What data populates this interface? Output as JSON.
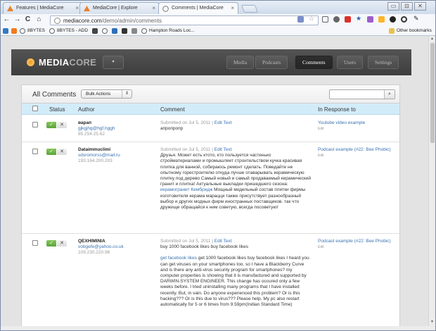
{
  "browser": {
    "tabs": [
      {
        "label": "Features | MediaCore",
        "active": false
      },
      {
        "label": "MediaCore | Explore",
        "active": false
      },
      {
        "label": "Comments | MediaCore",
        "active": true
      }
    ],
    "url_host": "mediacore.com",
    "url_path": "/demo/admin/comments",
    "bookmarks": [
      "8BYTES",
      "8BYTES - ADD",
      "Hampton Roads Loc..."
    ],
    "other_bookmarks": "Other bookmarks"
  },
  "app": {
    "logo_main": "MEDIA",
    "logo_accent": "CORE",
    "nav": [
      "Media",
      "Podcasts",
      "Comments",
      "Users",
      "Settings"
    ],
    "active_nav": "Comments"
  },
  "panel": {
    "title": "All Comments",
    "bulk_actions": "Bulk Actions",
    "headers": {
      "status": "Status",
      "author": "Author",
      "comment": "Comment",
      "response": "In Response to"
    }
  },
  "rows": [
    {
      "author": "варап",
      "email": "gjkgjhg@hgf.hggh",
      "ip": "85.254.25.62",
      "meta": "Submitted on Jul 5, 2011 | ",
      "edit": "Edit Text",
      "text": "апропропр",
      "response": "Youtube video example",
      "response_edit": "Edit"
    },
    {
      "author": "Dataimmuclimi",
      "email": "sdsromorss@mail.ru",
      "ip": "193.164.200.203",
      "meta": "Submitted on Jul 5, 2011 | ",
      "edit": "Edit Text",
      "text_a": "Друзья. Может есть ктото, кто пользуется частенько стройматериалами и промышляет строительством кучка красивая плитка для ванной, собираюсь ремонт сделать. Поведайте не опытному горестроителю откуда лучше отаварывать керамическую плитку под дерево Самый новый и самый продаваемый керамический гранит и плитка! Актуальные выкладки пришедшего сезона: ",
      "text_link": "керамогранит Кембридж",
      "text_b": " Мощный модельный состав плитки фирмы изготовителя керама марацци также присутствует разнообразный выбор и других модных фирм иностранных поставщиков. так что дружище обращайся к ним советую, всегда посоветуют",
      "response": "Podcast example (#22: Bee Phobic)",
      "response_edit": "Edit"
    },
    {
      "author": "QEXHIMINIA",
      "email": "vobgefe@yahoo.co.uk",
      "ip": "109.230.220.96",
      "meta": "Submitted on Jul 5, 2011 | ",
      "edit": "Edit Text",
      "text_a": "buy 1000 facebook likes buy facebook likes",
      "text_link": "get facebook likes",
      "text_b": " get 1000 facebook likes buy facebook likes I heard you can get viruses on your smartphones too, so I have a Blackberry Curve and is there any anti-virus security program for smartphones? my computer properties is showing that it is manufactured and supported by DARWIN-SYSTEM ENGINEER. This change has occured only a few weeks before. I tried uninstalling many programs that I have installed recently. But, in vain. Do anyone experienced this problem? Or is this hacking??? Or is this due to virus??? Please help. My pc also restart automatically for 5 or 6 times from 9.59pm(Indian Standard Time)",
      "response": "Podcast example (#22: Bee Phobic)",
      "response_edit": "Edit"
    }
  ],
  "colors": {
    "accent": "#f2a232",
    "header_row": "#d3ecfa",
    "link": "#3a73b0",
    "approve": "#5aa43a"
  }
}
